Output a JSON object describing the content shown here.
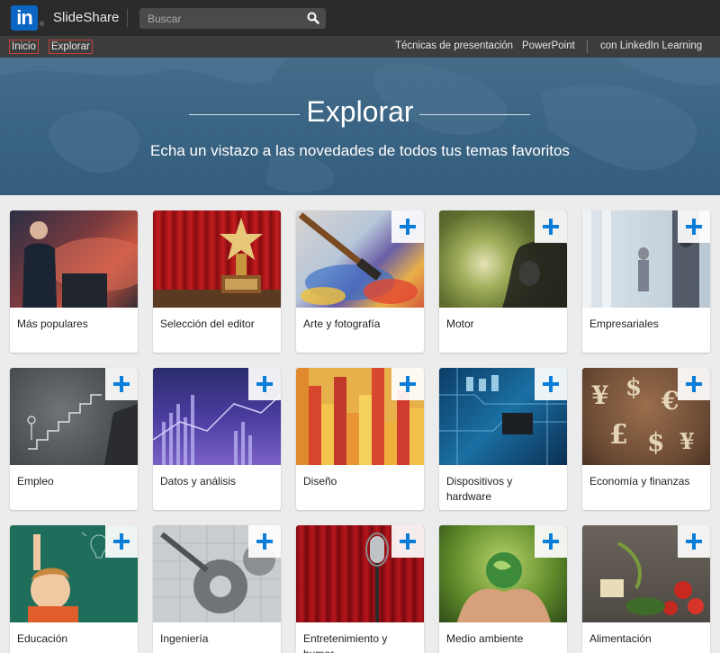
{
  "header": {
    "logo_text": "in",
    "logo_reg": "®",
    "brand": "SlideShare",
    "search_placeholder": "Buscar"
  },
  "nav": {
    "inicio": "Inicio",
    "explorar": "Explorar",
    "tecnicas": "Técnicas de presentación",
    "powerpoint": "PowerPoint",
    "learning": "con LinkedIn Learning"
  },
  "hero": {
    "title": "Explorar",
    "subtitle": "Echa un vistazo a las novedades de todos tus temas favoritos"
  },
  "categories": [
    {
      "label": "Más populares",
      "has_plus": false
    },
    {
      "label": "Selección del editor",
      "has_plus": false
    },
    {
      "label": "Arte y fotografía",
      "has_plus": true
    },
    {
      "label": "Motor",
      "has_plus": true
    },
    {
      "label": "Empresariales",
      "has_plus": true
    },
    {
      "label": "Empleo",
      "has_plus": true
    },
    {
      "label": "Datos y análisis",
      "has_plus": true
    },
    {
      "label": "Diseño",
      "has_plus": true
    },
    {
      "label": "Dispositivos y hardware",
      "has_plus": true
    },
    {
      "label": "Economía y finanzas",
      "has_plus": true
    },
    {
      "label": "Educación",
      "has_plus": true
    },
    {
      "label": "Ingeniería",
      "has_plus": true
    },
    {
      "label": "Entretenimiento y humor",
      "has_plus": true
    },
    {
      "label": "Medio ambiente",
      "has_plus": true
    },
    {
      "label": "Alimentación",
      "has_plus": true
    }
  ],
  "colors": {
    "linkedin_blue": "#0a66c2",
    "plus_blue": "#0a7dd8",
    "topbar": "#2b2b2b",
    "navbar": "#3d3d3d"
  }
}
